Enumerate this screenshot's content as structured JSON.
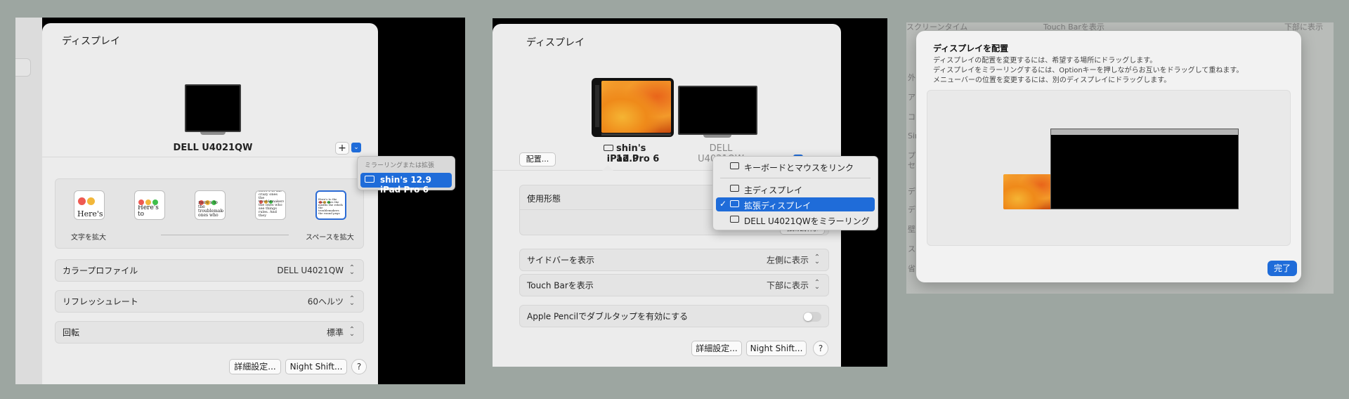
{
  "shot1": {
    "pane_title": "ディスプレイ",
    "monitor_name": "DELL U4021QW",
    "add_button": "+",
    "popup": {
      "header": "ミラーリングまたは拡張",
      "item": "shin's 12.9 iPad Pro 6"
    },
    "scale": {
      "thumb_texts": [
        "Here's",
        "Here's to",
        "Here's to the troublemakers ones who",
        "Here's to the crazy ones the troublemakers the ones who see things rules. And they",
        "Here's to the crazy ones the misfits the rebels the troublemakers the round pegs"
      ],
      "left_caption": "文字を拡大",
      "right_caption": "スペースを拡大"
    },
    "rows": [
      {
        "label": "カラープロファイル",
        "value": "DELL U4021QW"
      },
      {
        "label": "リフレッシュレート",
        "value": "60ヘルツ"
      },
      {
        "label": "回転",
        "value": "標準"
      }
    ],
    "advanced_button": "詳細設定...",
    "nightshift_button": "Night Shift...",
    "help": "?"
  },
  "shot2": {
    "pane_title": "ディスプレイ",
    "arrange_button": "配置...",
    "ipad_name_line1": "shin's 12.9",
    "ipad_name_line2": "iPad Pro 6",
    "dell_name": "DELL U4021QW",
    "use_as_label": "使用形態",
    "menu": {
      "items": [
        {
          "label": "キーボードとマウスをリンク",
          "checked": false,
          "highlighted": false
        },
        {
          "label": "主ディスプレイ",
          "checked": false,
          "highlighted": false
        },
        {
          "label": "拡張ディスプレイ",
          "checked": true,
          "highlighted": true
        },
        {
          "label": "DELL U4021QWをミラーリング",
          "checked": false,
          "highlighted": false
        }
      ],
      "check_mark": "✓"
    },
    "hidden_button_text": "接続解除",
    "rows": [
      {
        "label": "サイドバーを表示",
        "value": "左側に表示"
      },
      {
        "label": "Touch Barを表示",
        "value": "下部に表示"
      }
    ],
    "pencil_label": "Apple Pencilでダブルタップを有効にする",
    "pencil_enabled": false,
    "advanced_button": "詳細設定...",
    "nightshift_button": "Night Shift...",
    "help": "?"
  },
  "shot3": {
    "background_texts": [
      "スクリーンタイム",
      "Touch Barを表示",
      "下部に表示",
      "外",
      "ア",
      "コ",
      "Sir",
      "プ",
      "セ",
      "デ",
      "デ",
      "壁",
      "ス",
      "省"
    ],
    "dialog": {
      "title": "ディスプレイを配置",
      "lines": [
        "ディスプレイの配置を変更するには、希望する場所にドラッグします。",
        "ディスプレイをミラーリングするには、Optionキーを押しながらお互いをドラッグして重ねます。",
        "メニューバーの位置を変更するには、別のディスプレイにドラッグします。"
      ],
      "done_button": "完了"
    }
  },
  "colors": {
    "accent": "#1f6cd9",
    "traffic_red": "#ee5a52",
    "traffic_yellow": "#f2b73a",
    "traffic_green": "#3fbf4a"
  }
}
